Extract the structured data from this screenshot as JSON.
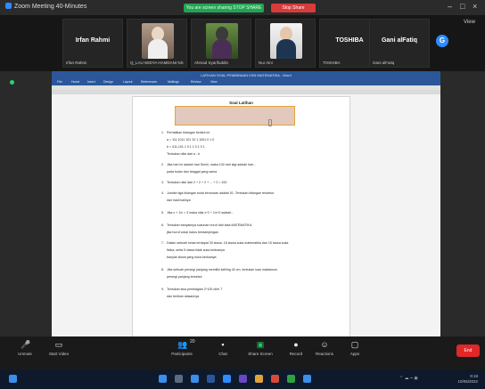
{
  "window": {
    "title": "Zoom Meeting 40-Minutes"
  },
  "share_banner": {
    "text": "You are screen sharing  STOP SHARE",
    "stop_label": "Stop Share"
  },
  "gallery": {
    "participants": [
      {
        "name": "Irfan Rahmi",
        "label": "Irfan Rahmi"
      },
      {
        "name": "",
        "label": "Q_LAU WIDYA HAMDANI NS"
      },
      {
        "name": "",
        "label": "Ahmad Syarifuddin"
      },
      {
        "name": "",
        "label": "Nur Aini"
      },
      {
        "name": "TOSHIBA",
        "label": "TOSHIBA"
      },
      {
        "name": "Gani alFatiq",
        "label": "Gani alFatiq"
      }
    ],
    "view_label": "View"
  },
  "word": {
    "doc_title": "LATIHAN SOAL PEMBINAAN KSN MATEMATIKA - Word",
    "tabs": [
      "File",
      "Home",
      "Insert",
      "Design",
      "Layout",
      "References",
      "Mailings",
      "Review",
      "View"
    ],
    "page_heading": "Soal Latihan",
    "items": [
      {
        "n": "1.",
        "text": "Perhatikan bilangan berikut ini"
      },
      {
        "n": "",
        "text": "a = 111,1011 101 10 1 1001 0 1 0"
      },
      {
        "n": "",
        "text": "b = 011,101 1 0 1 1 0 1 0 1"
      },
      {
        "n": "",
        "text": "Tentukan nilai dari a - b"
      },
      {
        "n": "2.",
        "text": "Jika hari ini adalah hari Senin, maka 100 hari lagi adalah hari..."
      },
      {
        "n": "",
        "text": "pada bulan dan tanggal yang sama"
      },
      {
        "n": "3.",
        "text": "Tentukan nilai dari 2 + 2 + 2 + ... + 2 = 100"
      },
      {
        "n": "4.",
        "text": "Jumlah tiga bilangan bulat berurutan adalah 51. Tentukan bilangan tersebut"
      },
      {
        "n": "",
        "text": "dan hasil kalinya"
      },
      {
        "n": "5.",
        "text": "Jika x + 1/x = 3 maka nilai x^2 + 1/x^2 adalah..."
      },
      {
        "n": "6.",
        "text": "Tentukan banyaknya susunan huruf dari kata MATEMATIKA"
      },
      {
        "n": "",
        "text": "jika huruf vokal harus berdampingan"
      },
      {
        "n": "7.",
        "text": "Dalam sebuah kelas terdapat 30 siswa, 18 siswa suka matematika dan 15 siswa suka"
      },
      {
        "n": "",
        "text": "fisika, serta 5 siswa tidak suka keduanya"
      },
      {
        "n": "",
        "text": "banyak siswa yang suka keduanya"
      },
      {
        "n": "8.",
        "text": "Jika sebuah persegi panjang memiliki keliling 40 cm, tentukan luas maksimum"
      },
      {
        "n": "",
        "text": "persegi panjang tersebut"
      },
      {
        "n": "9.",
        "text": "Tentukan sisa pembagian 2^100 oleh 7"
      },
      {
        "n": "",
        "text": "dan berikan alasannya"
      }
    ]
  },
  "toolbar": {
    "buttons": [
      {
        "label": "Unmute",
        "icon": "mic-icon"
      },
      {
        "label": "Start Video",
        "icon": "video-icon"
      },
      {
        "label": "Participants",
        "icon": "participants-icon"
      },
      {
        "label": "Chat",
        "icon": "chat-icon"
      },
      {
        "label": "Share Screen",
        "icon": "share-screen-icon"
      },
      {
        "label": "Record",
        "icon": "record-icon"
      },
      {
        "label": "Reactions",
        "icon": "reactions-icon"
      },
      {
        "label": "Apps",
        "icon": "apps-icon"
      }
    ],
    "participants_count": "20",
    "end_label": "End"
  },
  "taskbar": {
    "time": "9:18",
    "date": "10/05/2022"
  }
}
